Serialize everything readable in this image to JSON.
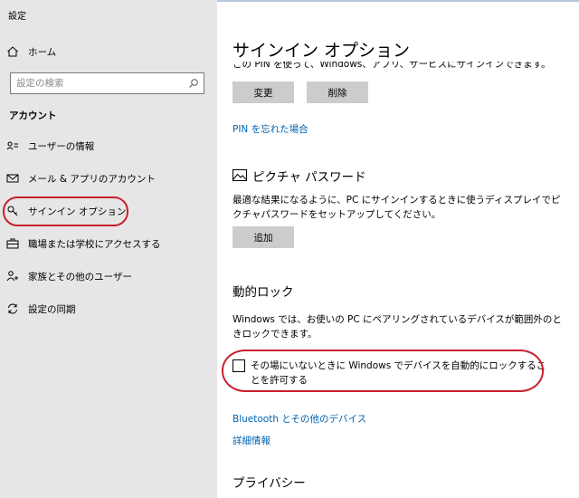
{
  "window": {
    "title": "設定"
  },
  "sidebar": {
    "home_label": "ホーム",
    "search": {
      "placeholder": "設定の検索"
    },
    "section_label": "アカウント",
    "items": [
      {
        "label": "ユーザーの情報",
        "icon": "user-info-icon"
      },
      {
        "label": "メール & アプリのアカウント",
        "icon": "mail-icon"
      },
      {
        "label": "サインイン オプション",
        "icon": "key-icon",
        "highlighted": true
      },
      {
        "label": "職場または学校にアクセスする",
        "icon": "briefcase-icon"
      },
      {
        "label": "家族とその他のユーザー",
        "icon": "person-add-icon"
      },
      {
        "label": "設定の同期",
        "icon": "sync-icon"
      }
    ]
  },
  "main": {
    "title": "サインイン オプション",
    "pin": {
      "description_partial": "この PIN を使って、Windows、アプリ、サービスにサインインできます。",
      "change_label": "変更",
      "delete_label": "削除",
      "forgot_link": "PIN を忘れた場合"
    },
    "picture_password": {
      "heading": "ピクチャ パスワード",
      "description": "最適な結果になるように、PC にサインインするときに使うディスプレイでピクチャパスワードをセットアップしてください。",
      "add_label": "追加"
    },
    "dynamic_lock": {
      "heading": "動的ロック",
      "description": "Windows では、お使いの PC にペアリングされているデバイスが範囲外のときロックできます。",
      "checkbox_label": "その場にいないときに Windows でデバイスを自動的にロックすることを許可する",
      "checked": false
    },
    "bluetooth_link": "Bluetooth とその他のデバイス",
    "more_info_link": "詳細情報",
    "privacy_heading": "プライバシー"
  },
  "colors": {
    "accent": "#0063b1",
    "highlight": "#c8202c",
    "sidebar_bg": "#e6e6e6",
    "button_bg": "#cccccc"
  }
}
